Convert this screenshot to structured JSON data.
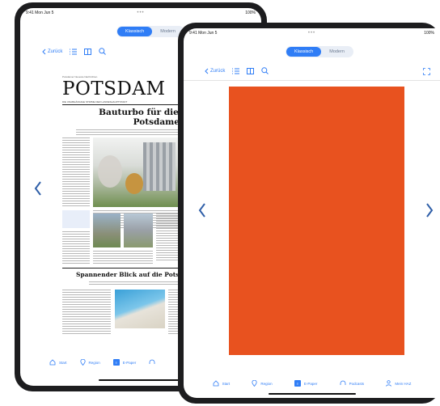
{
  "back_device": {
    "status": {
      "time": "9:41  Mon Jun 5",
      "right": "100%"
    },
    "segment": {
      "classic": "Klassisch",
      "modern": "Modern"
    },
    "toolbar": {
      "back": "Zurück"
    },
    "newspaper": {
      "kicker": "Potsdamer Neueste Nachrichten",
      "masthead": "POTSDAM",
      "tagline": "DIE UNABHÄNGIGE STIMME DER LANDESHAUPTSTADT",
      "headline1": "Bauturbo für die Erweiterung des Potsdamer Kirchsteigfelds",
      "headline2": "Spannender Blick auf die Potsdamer Mitte"
    },
    "nav": [
      {
        "icon": "home-icon",
        "label": "Start"
      },
      {
        "icon": "location-icon",
        "label": "Region"
      },
      {
        "icon": "epaper-icon",
        "label": "E-Paper"
      },
      {
        "icon": "headphones-icon",
        "label": ""
      }
    ]
  },
  "front_device": {
    "status": {
      "time": "9:41  Mon Jun 5",
      "right": "100%"
    },
    "segment": {
      "classic": "Klassisch",
      "modern": "Modern"
    },
    "toolbar": {
      "back": "Zurück"
    },
    "page_color": "#e8521f",
    "nav": [
      {
        "icon": "home-icon",
        "label": "Start"
      },
      {
        "icon": "location-icon",
        "label": "Region"
      },
      {
        "icon": "epaper-icon",
        "label": "E-Paper"
      },
      {
        "icon": "headphones-icon",
        "label": "Podcasts"
      },
      {
        "icon": "person-icon",
        "label": "Mein HAZ"
      }
    ]
  }
}
